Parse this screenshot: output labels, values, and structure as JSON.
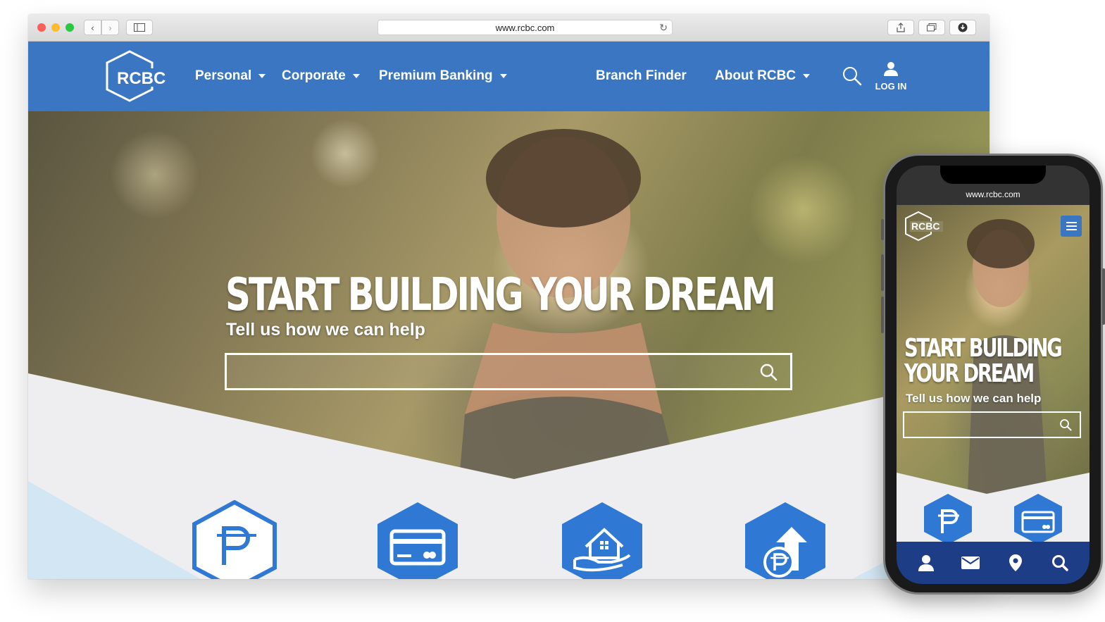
{
  "browser": {
    "url": "www.rcbc.com"
  },
  "site": {
    "logo_text": "RCBC",
    "nav": [
      {
        "label": "Personal",
        "has_dropdown": true
      },
      {
        "label": "Corporate",
        "has_dropdown": true
      },
      {
        "label": "Premium Banking",
        "has_dropdown": true
      },
      {
        "label": "Branch Finder",
        "has_dropdown": false
      },
      {
        "label": "About RCBC",
        "has_dropdown": true
      }
    ],
    "login_label": "LOG IN",
    "hero": {
      "title": "START BUILDING YOUR DREAM",
      "subtitle": "Tell us how we can help",
      "search_placeholder": ""
    },
    "feature_tiles": [
      {
        "icon": "peso-icon",
        "style": "outline"
      },
      {
        "icon": "credit-card-icon",
        "style": "filled"
      },
      {
        "icon": "home-loan-icon",
        "style": "filled"
      },
      {
        "icon": "peso-growth-icon",
        "style": "filled"
      }
    ]
  },
  "phone": {
    "url": "www.rcbc.com",
    "logo_text": "RCBC",
    "hero_title_line1": "START BUILDING",
    "hero_title_line2": "YOUR DREAM",
    "hero_subtitle": "Tell us how we can help",
    "bottom_nav": [
      "user-icon",
      "mail-icon",
      "location-pin-icon",
      "search-icon"
    ]
  },
  "colors": {
    "brand_blue": "#3b76c2",
    "tile_blue": "#2f78d4",
    "phone_nav_blue": "#1d3e86",
    "light_blue": "#d6e8f5",
    "hero_light": "#eeeef0"
  }
}
